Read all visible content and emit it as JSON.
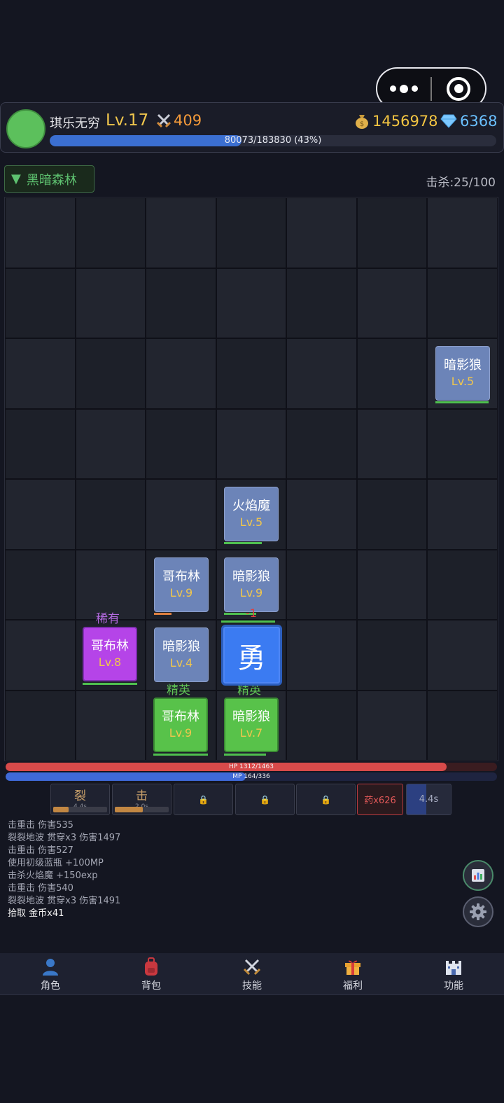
{
  "player": {
    "name": "琪乐无穷",
    "level": "Lv.17",
    "power": "409",
    "gold": "1456978",
    "gems": "6368",
    "exp_text": "80073/183830 (43%)",
    "exp_fraction": 0.43
  },
  "map": {
    "name": "黑暗森林",
    "kills": "击杀:25/100"
  },
  "units": [
    {
      "name": "暗影狼",
      "level": "Lv.5"
    },
    {
      "name": "火焰魔",
      "level": "Lv.5"
    },
    {
      "name": "哥布林",
      "level": "Lv.9"
    },
    {
      "name": "暗影狼",
      "level": "Lv.9"
    },
    {
      "name": "哥布林",
      "level": "Lv.8",
      "tag": "稀有"
    },
    {
      "name": "暗影狼",
      "level": "Lv.4"
    },
    {
      "name": "哥布林",
      "level": "Lv.9",
      "tag": "精英"
    },
    {
      "name": "暗影狼",
      "level": "Lv.7",
      "tag": "精英"
    }
  ],
  "hero": {
    "glyph": "勇",
    "damage_float": "-1"
  },
  "stats": {
    "hp_text": "HP 1312/1463",
    "hp_fraction": 0.897,
    "mp_text": "MP 164/336",
    "mp_fraction": 0.488
  },
  "skills": [
    {
      "name": "裂",
      "cd": "4.4s",
      "progress": 0.3
    },
    {
      "name": "击",
      "cd": "2.0s",
      "progress": 0.55
    }
  ],
  "potion": "药x626",
  "cooldown": {
    "text": "4.4s",
    "progress": 0.45
  },
  "log": [
    "击重击 伤害535",
    "裂裂地波 贯穿x3 伤害1497",
    "击重击 伤害527",
    "使用初级蓝瓶 +100MP",
    "击杀火焰魔 +150exp",
    "击重击 伤害540",
    "裂裂地波 贯穿x3 伤害1491",
    "拾取 金币x41"
  ],
  "nav": [
    {
      "label": "角色",
      "icon": "person-icon"
    },
    {
      "label": "背包",
      "icon": "backpack-icon"
    },
    {
      "label": "技能",
      "icon": "crossed-swords-icon"
    },
    {
      "label": "福利",
      "icon": "gift-icon"
    },
    {
      "label": "功能",
      "icon": "castle-icon"
    }
  ],
  "colors": {
    "background": "#141621",
    "gold": "#f4c542",
    "hp": "#d84a4a",
    "mp": "#3f6ad8",
    "hero": "#3b7bf2",
    "rare": "#b544e8",
    "elite": "#58c24a"
  }
}
